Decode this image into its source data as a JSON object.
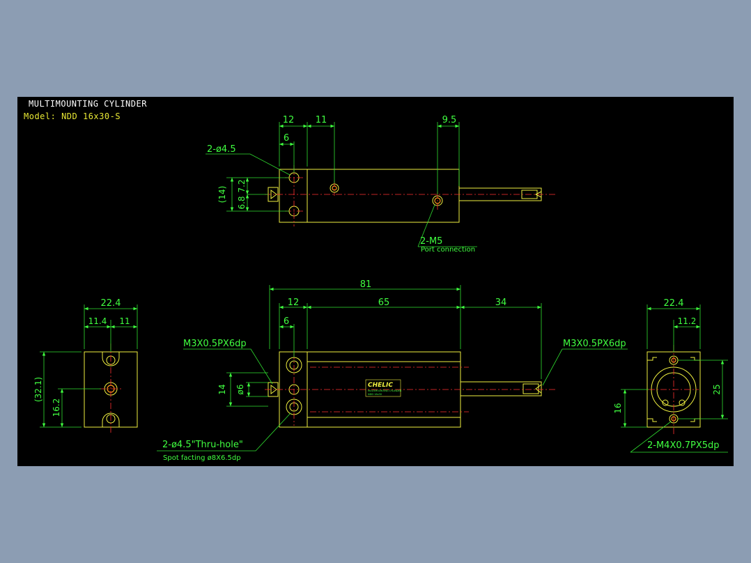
{
  "title": {
    "line1": "MULTIMOUNTING CYLINDER",
    "line2": "Model: NDD 16x30-S"
  },
  "top_view": {
    "dim_12": "12",
    "dim_11": "11",
    "dim_9_5": "9.5",
    "dim_6": "6",
    "dim_7_2": "7.2",
    "dim_6_8": "6.8",
    "dim_14_ref": "(14)",
    "hole_label": "2-ø4.5",
    "port_label": "2-M5",
    "port_note": "Port connection"
  },
  "left_view": {
    "dim_22_4": "22.4",
    "dim_11_4": "11.4",
    "dim_11": "11",
    "dim_32_1": "(32.1)",
    "dim_16_2": "16.2"
  },
  "front_view": {
    "dim_81": "81",
    "dim_12": "12",
    "dim_65": "65",
    "dim_34": "34",
    "dim_6": "6",
    "dim_14": "14",
    "dim_phi6": "ø6",
    "thread_left": "M3X0.5PX6dp",
    "thread_right": "M3X0.5PX6dp",
    "hole_label": "2-ø4.5\"Thru-hole\"",
    "spot_label": "Spot facting ø8X6.5dp",
    "brand": "CHELIC",
    "brand_sub1": "MULTIMOUNTING CYLINDER",
    "brand_sub2": "NDD 16x30"
  },
  "right_view": {
    "dim_22_4": "22.4",
    "dim_11_2": "11.2",
    "dim_25": "25",
    "dim_16": "16",
    "thread_label": "2-M4X0.7PX5dp"
  }
}
